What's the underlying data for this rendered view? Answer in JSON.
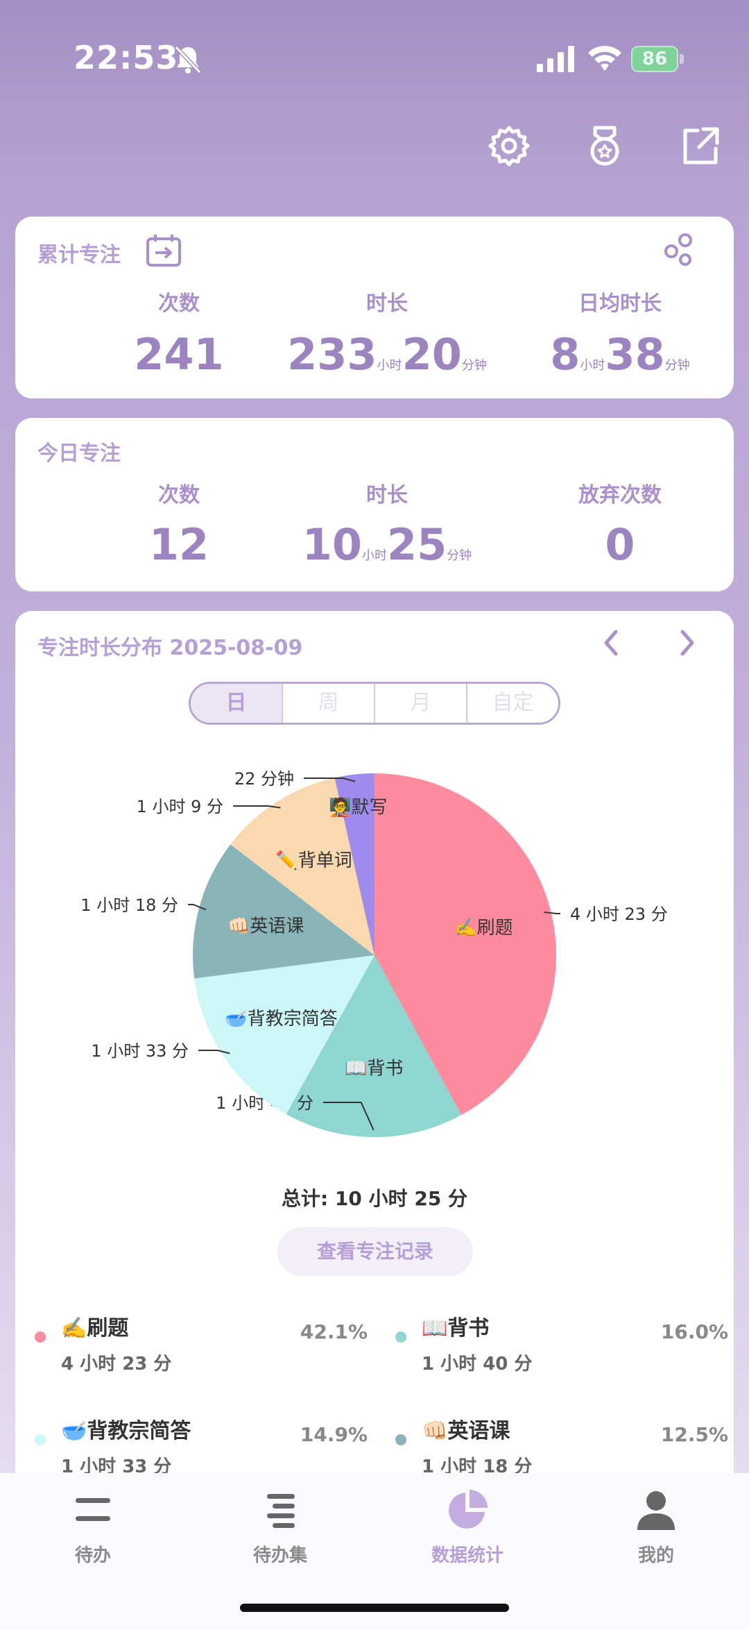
{
  "status": {
    "time": "22:53",
    "battery": "86"
  },
  "top_icons": [
    "gear-icon",
    "medal-icon",
    "share-icon"
  ],
  "cumulative": {
    "title": "累计专注",
    "count_label": "次数",
    "count": "241",
    "duration_label": "时长",
    "duration_hours": "233",
    "duration_hours_unit": "小时",
    "duration_minutes": "20",
    "duration_minutes_unit": "分钟",
    "daily_label": "日均时长",
    "daily_hours": "8",
    "daily_hours_unit": "小时",
    "daily_minutes": "38",
    "daily_minutes_unit": "分钟"
  },
  "today": {
    "title": "今日专注",
    "count_label": "次数",
    "count": "12",
    "duration_label": "时长",
    "duration_hours": "10",
    "duration_hours_unit": "小时",
    "duration_minutes": "25",
    "duration_minutes_unit": "分钟",
    "abandon_label": "放弃次数",
    "abandon": "0"
  },
  "distribution": {
    "title": "专注时长分布 2025-08-09",
    "tabs": [
      "日",
      "周",
      "月",
      "自定"
    ],
    "active_tab": "日",
    "total": "总计: 10 小时 25 分",
    "record_button": "查看专注记录"
  },
  "chart_data": {
    "type": "pie",
    "slices": [
      {
        "name": "✍️刷题",
        "value_label": "4 小时 23 分",
        "minutes": 263,
        "color": "#ff8c9e"
      },
      {
        "name": "📖背书",
        "value_label": "1 小时 40 分",
        "minutes": 100,
        "color": "#8fd5d0"
      },
      {
        "name": "🥣背教宗简答",
        "value_label": "1 小时 33 分",
        "minutes": 93,
        "color": "#cdf6f6"
      },
      {
        "name": "👊🏻英语课",
        "value_label": "1 小时 18 分",
        "minutes": 78,
        "color": "#8ab5b8"
      },
      {
        "name": "✏️背单词",
        "value_label": "1 小时 9 分",
        "minutes": 69,
        "color": "#fad9b1"
      },
      {
        "name": "🧑‍🏫默写",
        "value_label": "22 分钟",
        "minutes": 22,
        "color": "#9d8bee"
      }
    ]
  },
  "legend": [
    {
      "name": "✍️刷题",
      "time": "4 小时 23 分",
      "percent": "42.1%",
      "color": "#ff8c9e"
    },
    {
      "name": "📖背书",
      "time": "1 小时 40 分",
      "percent": "16.0%",
      "color": "#8fd5d0"
    },
    {
      "name": "🥣背教宗简答",
      "time": "1 小时 33 分",
      "percent": "14.9%",
      "color": "#cdf6f6"
    },
    {
      "name": "👊🏻英语课",
      "time": "1 小时 18 分",
      "percent": "12.5%",
      "color": "#8ab5b8"
    }
  ],
  "tabs": [
    {
      "label": "待办",
      "icon": "lines-icon"
    },
    {
      "label": "待办集",
      "icon": "list-icon"
    },
    {
      "label": "数据统计",
      "icon": "pie-chart-icon"
    },
    {
      "label": "我的",
      "icon": "person-icon"
    }
  ]
}
